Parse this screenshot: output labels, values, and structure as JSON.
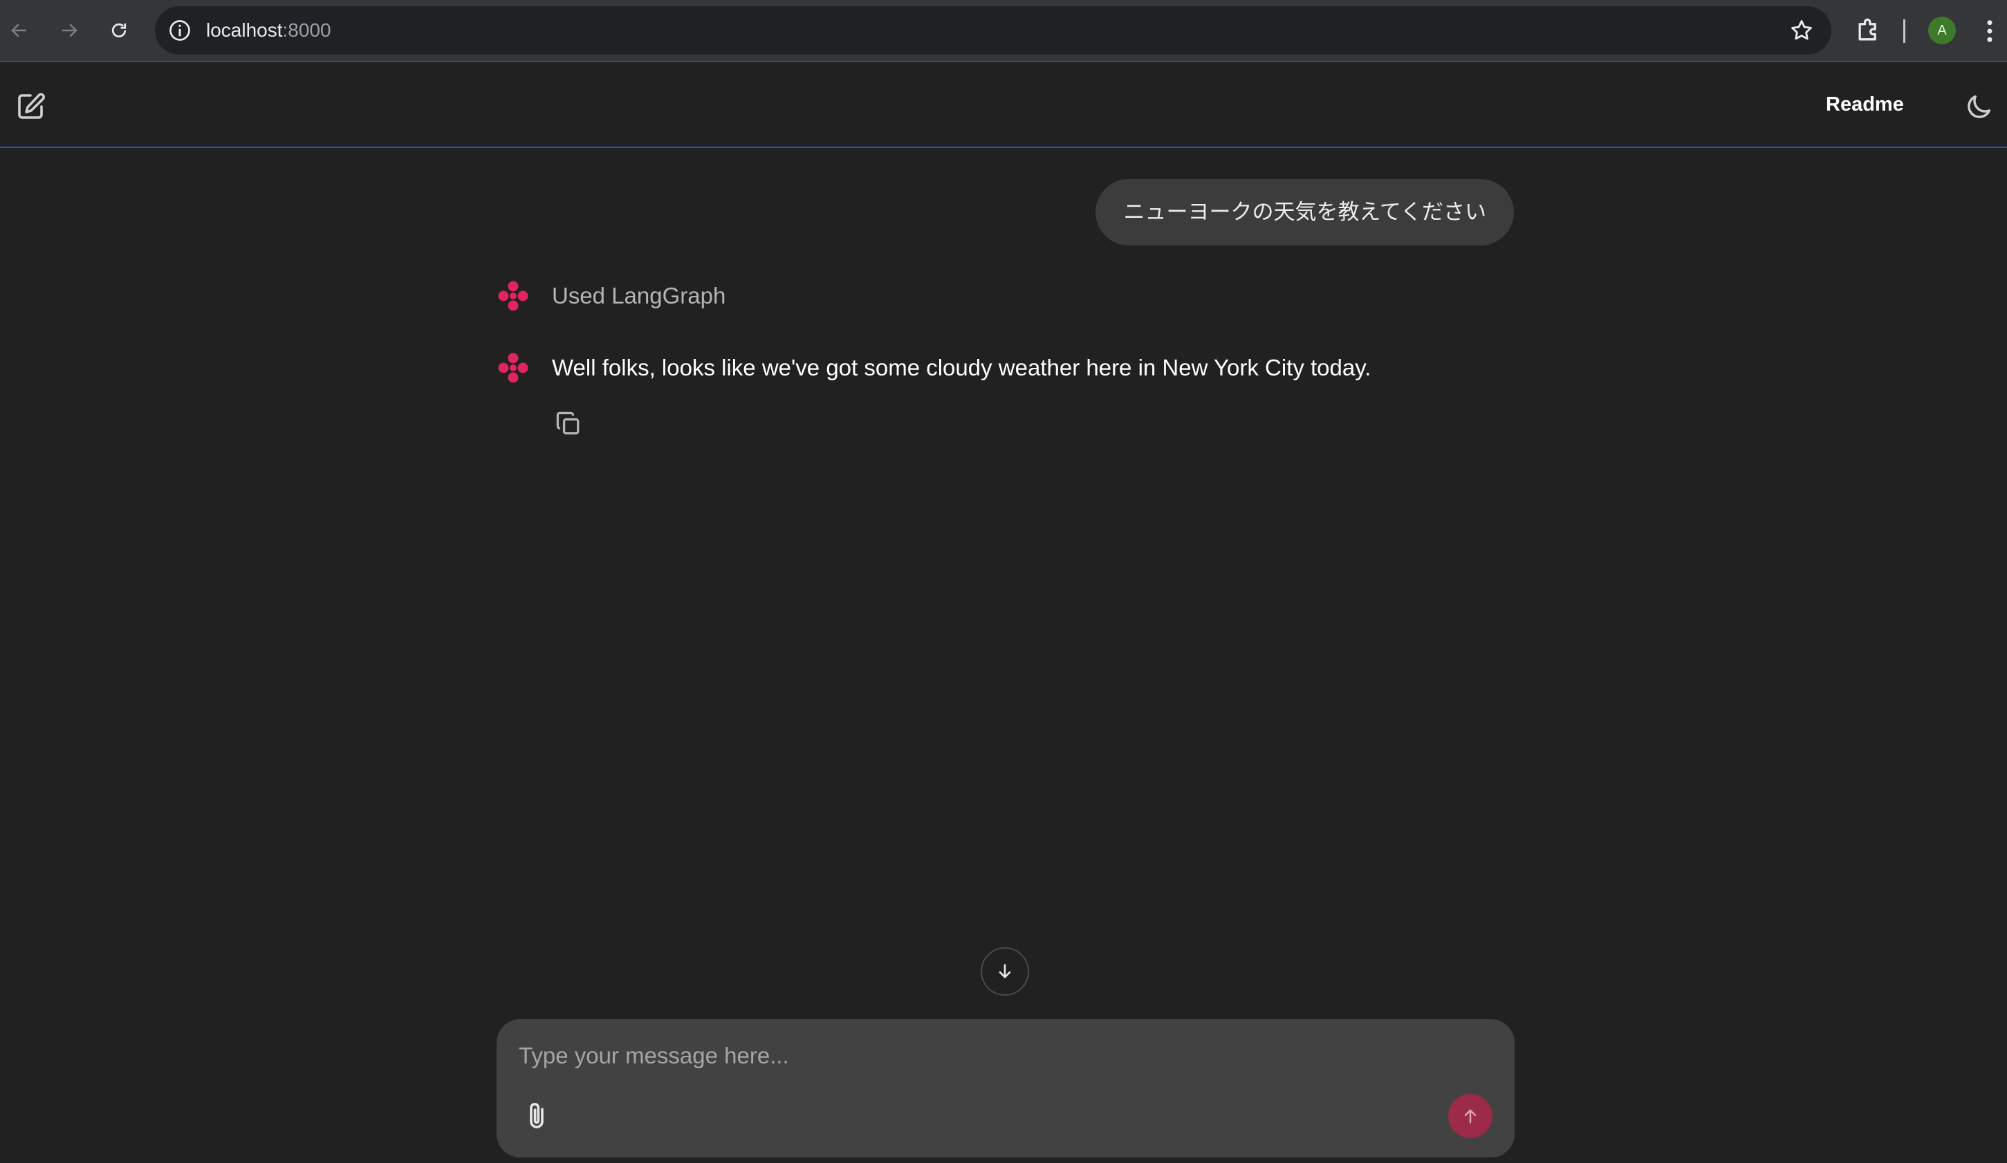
{
  "browser": {
    "url_host": "localhost",
    "url_port": ":8000",
    "profile_initial": "A"
  },
  "header": {
    "readme_label": "Readme"
  },
  "chat": {
    "user_message": "ニューヨークの天気を教えてください",
    "tool_status": "Used LangGraph",
    "assistant_message": "Well folks, looks like we've got some cloudy weather here in New York City today."
  },
  "composer": {
    "placeholder": "Type your message here..."
  },
  "colors": {
    "accent": "#e0245e",
    "send_button": "#9b2b48",
    "header_border": "#2f4fa8"
  }
}
